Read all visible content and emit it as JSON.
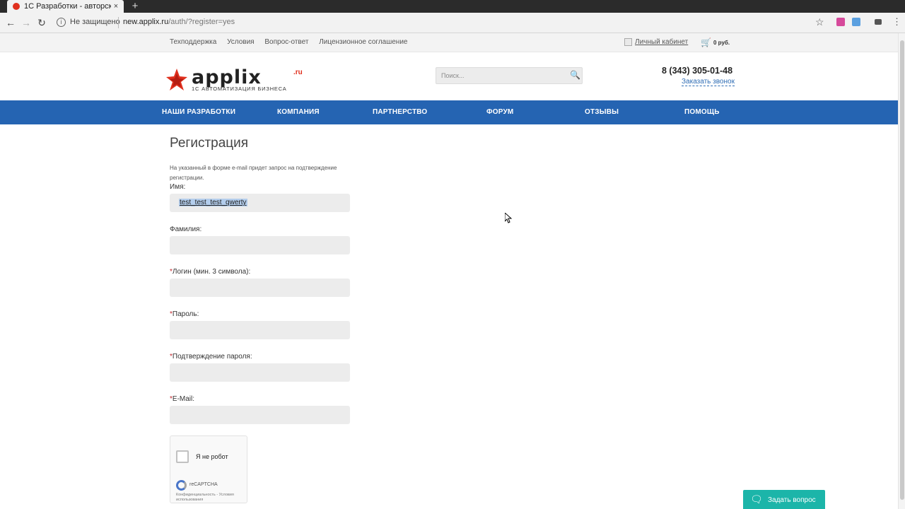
{
  "browser": {
    "tab_title": "1С Разработки - авторск",
    "tab_close": "×",
    "new_tab": "+",
    "back": "←",
    "forward": "→",
    "reload": "↻",
    "security_text": "Не защищено",
    "url_domain": "new.applix.ru",
    "url_path": "/auth/?register=yes",
    "bookmark_icon": "star-icon",
    "menu_icon": "⋮"
  },
  "topbar": {
    "links": [
      "Техподдержка",
      "Условия",
      "Вопрос-ответ",
      "Лицензионное соглашение"
    ],
    "account_link": "Личный кабинет",
    "cart_icon": "🛒",
    "cart_sum": "0 руб."
  },
  "header": {
    "logo_text": "applix",
    "logo_domain": ".ru",
    "logo_tagline": "1С АВТОМАТИЗАЦИЯ БИЗНЕСА",
    "search_placeholder": "Поиск...",
    "search_icon": "🔍",
    "phone": "8 (343) 305-01-48",
    "callback_link": "Заказать звонок"
  },
  "nav": {
    "items": [
      "НАШИ РАЗРАБОТКИ",
      "КОМПАНИЯ",
      "ПАРТНЕРСТВО",
      "ФОРУМ",
      "ОТЗЫВЫ",
      "ПОМОЩЬ"
    ]
  },
  "form": {
    "title": "Регистрация",
    "note": "На указанный в форме e-mail придет запрос на подтверждение регистрации.",
    "required_mark": "*",
    "fields": [
      {
        "label": "Имя:",
        "value": "test_test_test_qwerty",
        "required": false
      },
      {
        "label": "Фамилия:",
        "value": "",
        "required": false
      },
      {
        "label": "Логин (мин. 3 символа):",
        "value": "",
        "required": true
      },
      {
        "label": "Пароль:",
        "value": "",
        "required": true
      },
      {
        "label": "Подтверждение пароля:",
        "value": "",
        "required": true
      },
      {
        "label": "E-Mail:",
        "value": "",
        "required": true
      }
    ],
    "captcha": {
      "label": "Я не робот",
      "brand": "reCAPTCHA",
      "terms": "Конфиденциальность - Условия использования"
    }
  },
  "ask_button": {
    "icon": "chat-bubbles-icon",
    "label": "Задать вопрос"
  },
  "colors": {
    "nav_bg": "#2564b2",
    "accent_red": "#e0301e",
    "ask_button_bg": "#1cb5a9",
    "link_blue": "#2f6db5"
  }
}
